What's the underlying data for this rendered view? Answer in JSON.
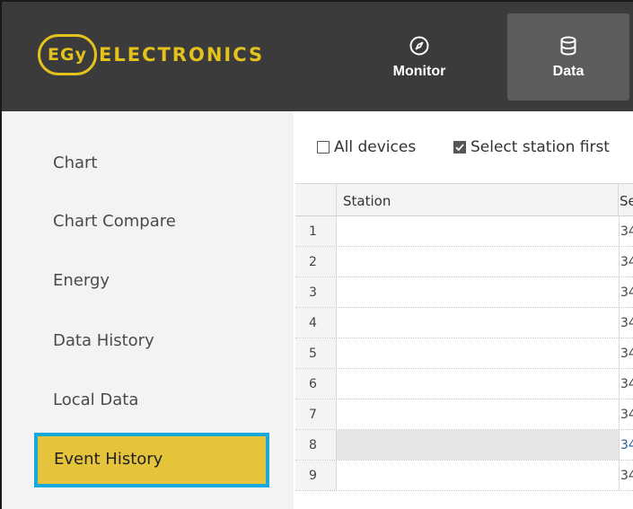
{
  "brand": {
    "badge": "EGy",
    "name": "ELECTRONICS",
    "color": "#e4c21e"
  },
  "nav": [
    {
      "label": "Monitor",
      "icon": "compass-icon",
      "active": false
    },
    {
      "label": "Data",
      "icon": "database-icon",
      "active": true
    }
  ],
  "sidebar": {
    "items": [
      {
        "label": "Chart"
      },
      {
        "label": "Chart Compare"
      },
      {
        "label": "Energy"
      },
      {
        "label": "Data History"
      },
      {
        "label": "Local Data"
      },
      {
        "label": "Event History",
        "active": true
      }
    ],
    "active_color": "#e5c43b",
    "active_border": "#18a8dc"
  },
  "toolbar": {
    "all_devices": {
      "label": "All devices",
      "checked": false
    },
    "select_station_first": {
      "label": "Select station first",
      "checked": true
    }
  },
  "table": {
    "columns": [
      "Station",
      "Se"
    ],
    "rows": [
      {
        "idx": "1",
        "station": "",
        "col3": "34",
        "selected": false
      },
      {
        "idx": "2",
        "station": "",
        "col3": "34",
        "selected": false
      },
      {
        "idx": "3",
        "station": "",
        "col3": "34",
        "selected": false
      },
      {
        "idx": "4",
        "station": "",
        "col3": "34",
        "selected": false
      },
      {
        "idx": "5",
        "station": "",
        "col3": "34",
        "selected": false
      },
      {
        "idx": "6",
        "station": "",
        "col3": "34",
        "selected": false
      },
      {
        "idx": "7",
        "station": "",
        "col3": "34",
        "selected": false
      },
      {
        "idx": "8",
        "station": "",
        "col3": "34",
        "selected": true
      },
      {
        "idx": "9",
        "station": "",
        "col3": "34",
        "selected": false
      }
    ]
  }
}
